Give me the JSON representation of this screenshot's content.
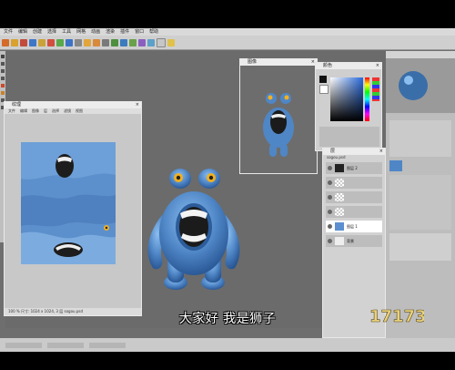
{
  "menubar": {
    "items": [
      "文件",
      "编辑",
      "创建",
      "选择",
      "工具",
      "网格",
      "动画",
      "渲染",
      "插件",
      "窗口",
      "帮助"
    ]
  },
  "texture_window": {
    "title": "纹理",
    "menu": [
      "文件",
      "编辑",
      "图像",
      "层",
      "选择",
      "滤镜",
      "视图"
    ],
    "footer": "100 %   尺寸: 1024 x 1024, 3 层   sogou.psd"
  },
  "render_window": {
    "title": "图像"
  },
  "color_window": {
    "title": "颜色"
  },
  "layer_window": {
    "title": "层",
    "file": "sogou.psd",
    "layers": [
      {
        "label": "图层 2",
        "active": false
      },
      {
        "label": "",
        "active": false
      },
      {
        "label": "",
        "active": false
      },
      {
        "label": "",
        "active": false
      },
      {
        "label": "图层 1",
        "active": true
      },
      {
        "label": "背景",
        "active": false
      }
    ]
  },
  "subtitle": "大家好 我是狮子",
  "watermark": "17173",
  "colors": {
    "monster_body": "#4f86c6",
    "monster_dark": "#2f5f9e",
    "eye": "#f2b01e",
    "viewport": "#6b6b6b"
  }
}
